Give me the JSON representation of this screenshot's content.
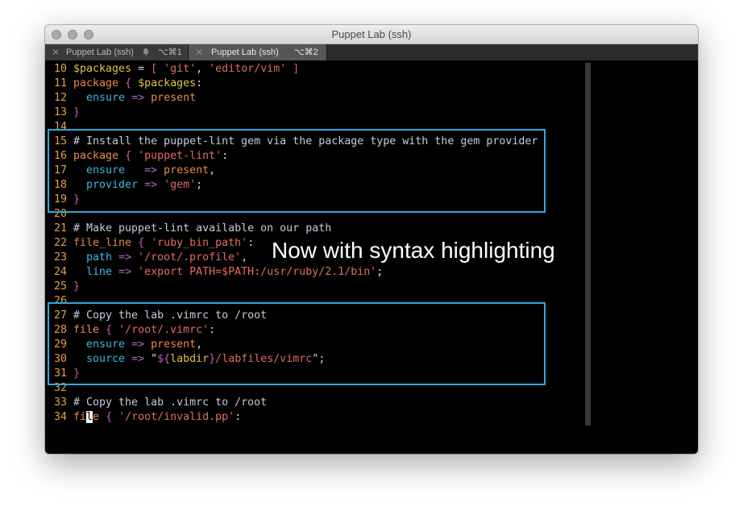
{
  "window": {
    "title": "Puppet Lab (ssh)"
  },
  "tabs": [
    {
      "label": "Puppet Lab (ssh)",
      "shortcut": "⌥⌘1",
      "active": false
    },
    {
      "label": "Puppet Lab (ssh)",
      "shortcut": "⌥⌘2",
      "active": true
    }
  ],
  "annotation": "Now with syntax highlighting",
  "colors": {
    "highlight_box": "#2eaadc",
    "line_number": "#e5a14a",
    "comment": "#c9c9e0",
    "string": "#e36b63",
    "keyword": "#e8894a",
    "attribute": "#43b6e0",
    "brace": "#cd5aa8",
    "variable": "#e3c24a"
  },
  "editor": {
    "lines": [
      {
        "n": "10",
        "tokens": [
          [
            "var",
            "$packages"
          ],
          [
            "plain",
            " = "
          ],
          [
            "brace",
            "["
          ],
          [
            "plain",
            " "
          ],
          [
            "str",
            "'git'"
          ],
          [
            "plain",
            ", "
          ],
          [
            "str",
            "'editor/vim'"
          ],
          [
            "plain",
            " "
          ],
          [
            "brace",
            "]"
          ]
        ]
      },
      {
        "n": "11",
        "tokens": [
          [
            "kw",
            "package"
          ],
          [
            "plain",
            " "
          ],
          [
            "brace",
            "{"
          ],
          [
            "plain",
            " "
          ],
          [
            "var",
            "$packages"
          ],
          [
            "plain",
            ":"
          ]
        ]
      },
      {
        "n": "12",
        "tokens": [
          [
            "plain",
            "  "
          ],
          [
            "attr",
            "ensure"
          ],
          [
            "plain",
            " "
          ],
          [
            "op",
            "=>"
          ],
          [
            "plain",
            " "
          ],
          [
            "val",
            "present"
          ]
        ]
      },
      {
        "n": "13",
        "tokens": [
          [
            "brace",
            "}"
          ]
        ]
      },
      {
        "n": "14",
        "tokens": []
      },
      {
        "n": "15",
        "tokens": [
          [
            "comment",
            "# Install the puppet-lint gem via the package type with the gem provider"
          ]
        ]
      },
      {
        "n": "16",
        "tokens": [
          [
            "kw",
            "package"
          ],
          [
            "plain",
            " "
          ],
          [
            "brace",
            "{"
          ],
          [
            "plain",
            " "
          ],
          [
            "str",
            "'puppet-lint'"
          ],
          [
            "plain",
            ":"
          ]
        ]
      },
      {
        "n": "17",
        "tokens": [
          [
            "plain",
            "  "
          ],
          [
            "attr",
            "ensure"
          ],
          [
            "plain",
            "   "
          ],
          [
            "op",
            "=>"
          ],
          [
            "plain",
            " "
          ],
          [
            "val",
            "present"
          ],
          [
            "plain",
            ","
          ]
        ]
      },
      {
        "n": "18",
        "tokens": [
          [
            "plain",
            "  "
          ],
          [
            "attr",
            "provider"
          ],
          [
            "plain",
            " "
          ],
          [
            "op",
            "=>"
          ],
          [
            "plain",
            " "
          ],
          [
            "str",
            "'gem'"
          ],
          [
            "plain",
            ";"
          ]
        ]
      },
      {
        "n": "19",
        "tokens": [
          [
            "brace",
            "}"
          ]
        ]
      },
      {
        "n": "20",
        "tokens": []
      },
      {
        "n": "21",
        "tokens": [
          [
            "comment",
            "# Make puppet-lint available on our path"
          ]
        ]
      },
      {
        "n": "22",
        "tokens": [
          [
            "kw",
            "file_line"
          ],
          [
            "plain",
            " "
          ],
          [
            "brace",
            "{"
          ],
          [
            "plain",
            " "
          ],
          [
            "str",
            "'ruby_bin_path'"
          ],
          [
            "plain",
            ":"
          ]
        ]
      },
      {
        "n": "23",
        "tokens": [
          [
            "plain",
            "  "
          ],
          [
            "attr",
            "path"
          ],
          [
            "plain",
            " "
          ],
          [
            "op",
            "=>"
          ],
          [
            "plain",
            " "
          ],
          [
            "str",
            "'/root/.profile'"
          ],
          [
            "plain",
            ","
          ]
        ]
      },
      {
        "n": "24",
        "tokens": [
          [
            "plain",
            "  "
          ],
          [
            "attr",
            "line"
          ],
          [
            "plain",
            " "
          ],
          [
            "op",
            "=>"
          ],
          [
            "plain",
            " "
          ],
          [
            "str",
            "'export PATH=$PATH:/usr/ruby/2.1/bin'"
          ],
          [
            "plain",
            ";"
          ]
        ]
      },
      {
        "n": "25",
        "tokens": [
          [
            "brace",
            "}"
          ]
        ]
      },
      {
        "n": "26",
        "tokens": []
      },
      {
        "n": "27",
        "tokens": [
          [
            "comment",
            "# Copy the lab .vimrc to /root"
          ]
        ]
      },
      {
        "n": "28",
        "tokens": [
          [
            "kw",
            "file"
          ],
          [
            "plain",
            " "
          ],
          [
            "brace",
            "{"
          ],
          [
            "plain",
            " "
          ],
          [
            "str",
            "'/root/.vimrc'"
          ],
          [
            "plain",
            ":"
          ]
        ]
      },
      {
        "n": "29",
        "tokens": [
          [
            "plain",
            "  "
          ],
          [
            "attr",
            "ensure"
          ],
          [
            "plain",
            " "
          ],
          [
            "op",
            "=>"
          ],
          [
            "plain",
            " "
          ],
          [
            "val",
            "present"
          ],
          [
            "plain",
            ","
          ]
        ]
      },
      {
        "n": "30",
        "tokens": [
          [
            "plain",
            "  "
          ],
          [
            "attr",
            "source"
          ],
          [
            "plain",
            " "
          ],
          [
            "op",
            "=>"
          ],
          [
            "plain",
            " "
          ],
          [
            "plain",
            "\""
          ],
          [
            "brace",
            "${"
          ],
          [
            "var",
            "labdir"
          ],
          [
            "brace",
            "}"
          ],
          [
            "path",
            "/labfiles/vimrc"
          ],
          [
            "plain",
            "\""
          ],
          [
            "plain",
            ";"
          ]
        ]
      },
      {
        "n": "31",
        "tokens": [
          [
            "brace",
            "}"
          ]
        ]
      },
      {
        "n": "32",
        "tokens": []
      },
      {
        "n": "33",
        "tokens": [
          [
            "comment",
            "# Copy the lab .vimrc to /root"
          ]
        ]
      },
      {
        "n": "34",
        "tokens": [
          [
            "kw",
            "fi"
          ],
          [
            "cursor",
            "l"
          ],
          [
            "kw",
            "e"
          ],
          [
            "plain",
            " "
          ],
          [
            "brace",
            "{"
          ],
          [
            "plain",
            " "
          ],
          [
            "str",
            "'/root/invalid.pp'"
          ],
          [
            "plain",
            ":"
          ]
        ]
      }
    ]
  }
}
